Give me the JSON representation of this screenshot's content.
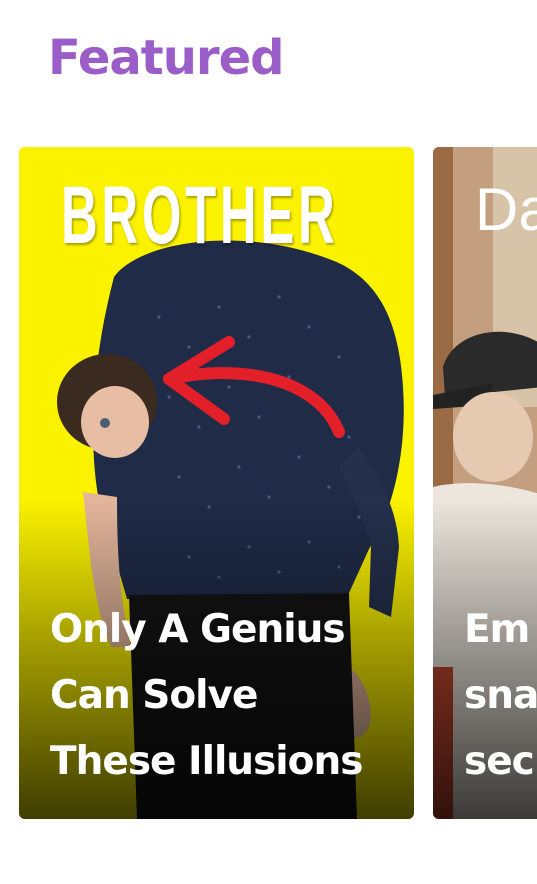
{
  "section": {
    "title": "Featured"
  },
  "cards": [
    {
      "overlay_word": "BROTHER",
      "headline_lines": [
        "Only A Genius",
        "Can Solve",
        "These Illusions"
      ],
      "colors": {
        "background": "#fbf200",
        "shirt": "#1e2a45",
        "arrow": "#e3202a"
      }
    },
    {
      "overlay_word": "Da",
      "headline_lines": [
        "Em",
        "sna",
        "sec"
      ],
      "colors": {
        "background": "#c7a789"
      }
    }
  ],
  "colors": {
    "accent": "#9b5ec9"
  }
}
